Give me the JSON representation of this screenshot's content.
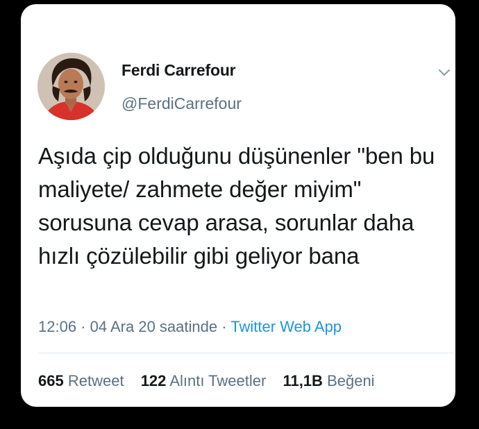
{
  "tweet": {
    "author": {
      "display_name": "Ferdi Carrefour",
      "handle": "@FerdiCarrefour"
    },
    "text": "Aşıda çip olduğunu düşünenler \"ben bu maliyete/ zahmete değer miyim\" sorusuna cevap arasa, sorunlar daha hızlı çözülebilir gibi geliyor bana",
    "meta": {
      "time": "12:06",
      "separator1": " · ",
      "date": "04 Ara 20 saatinde",
      "separator2": " · ",
      "source": "Twitter Web App"
    },
    "stats": {
      "retweets_count": "665",
      "retweets_label": "Retweet",
      "quotes_count": "122",
      "quotes_label": "Alıntı Tweetler",
      "likes_count": "11,1B",
      "likes_label": "Beğeni"
    },
    "icons": {
      "menu": "chevron-down-icon",
      "avatar": "profile-photo"
    },
    "colors": {
      "background": "#000000",
      "card": "#ffffff",
      "text": "#14171a",
      "secondary": "#5b7083",
      "link": "#1b95e0"
    }
  }
}
